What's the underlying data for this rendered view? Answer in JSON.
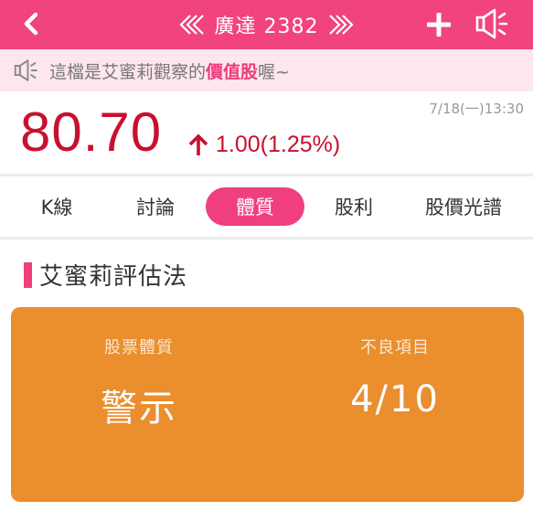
{
  "header": {
    "title": "廣達 2382",
    "icons": {
      "back": "chevron-left-icon",
      "prev": "double-chevron-left-icon",
      "next": "double-chevron-right-icon",
      "add": "plus-icon",
      "announce": "megaphone-icon"
    }
  },
  "notice": {
    "prefix": "這檔是艾蜜莉觀察的",
    "highlight": "價值股",
    "suffix": "喔~",
    "icon": "megaphone-icon"
  },
  "quote": {
    "price": "80.70",
    "direction": "up",
    "change": "1.00(1.25%)",
    "timestamp": "7/18(一)13:30"
  },
  "tabs": [
    {
      "label": "K線",
      "active": false
    },
    {
      "label": "討論",
      "active": false
    },
    {
      "label": "體質",
      "active": true
    },
    {
      "label": "股利",
      "active": false
    },
    {
      "label": "股價光譜",
      "active": false
    }
  ],
  "section": {
    "title": "艾蜜莉評估法"
  },
  "assessment": {
    "health_label": "股票體質",
    "health_value": "警示",
    "bad_items_label": "不良項目",
    "bad_items_value": "4/10"
  },
  "colors": {
    "brand_pink": "#f0437f",
    "price_red": "#c8102e",
    "warning_orange": "#ea8e2e"
  }
}
